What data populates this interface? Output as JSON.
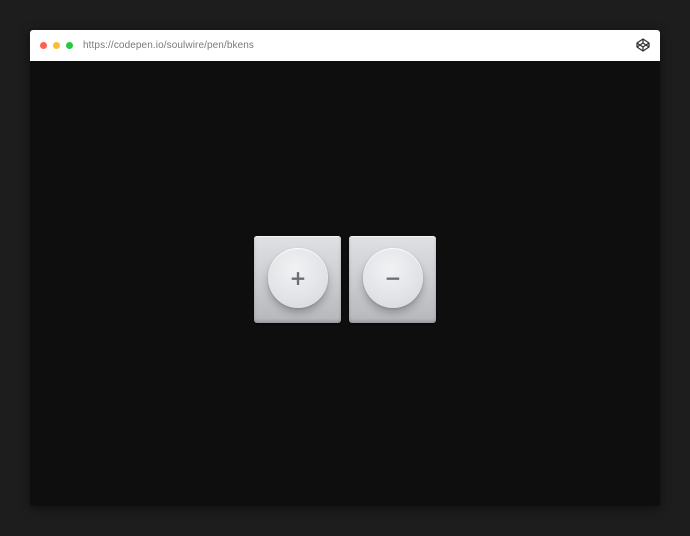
{
  "browser": {
    "url": "https://codepen.io/soulwire/pen/bkens",
    "traffic_lights": [
      {
        "name": "close",
        "color": "#ff5f57"
      },
      {
        "name": "minimize",
        "color": "#febc2e"
      },
      {
        "name": "zoom",
        "color": "#28c840"
      }
    ],
    "right_icon": "codepen-logo-icon"
  },
  "keys": [
    {
      "name": "plus",
      "glyph": "+"
    },
    {
      "name": "minus",
      "glyph": "−"
    }
  ],
  "colors": {
    "page_background": "#1d1d1d",
    "content_background": "#0e0e0e",
    "key_surface": "#cfd1d4",
    "glyph": "#6c6e72"
  }
}
